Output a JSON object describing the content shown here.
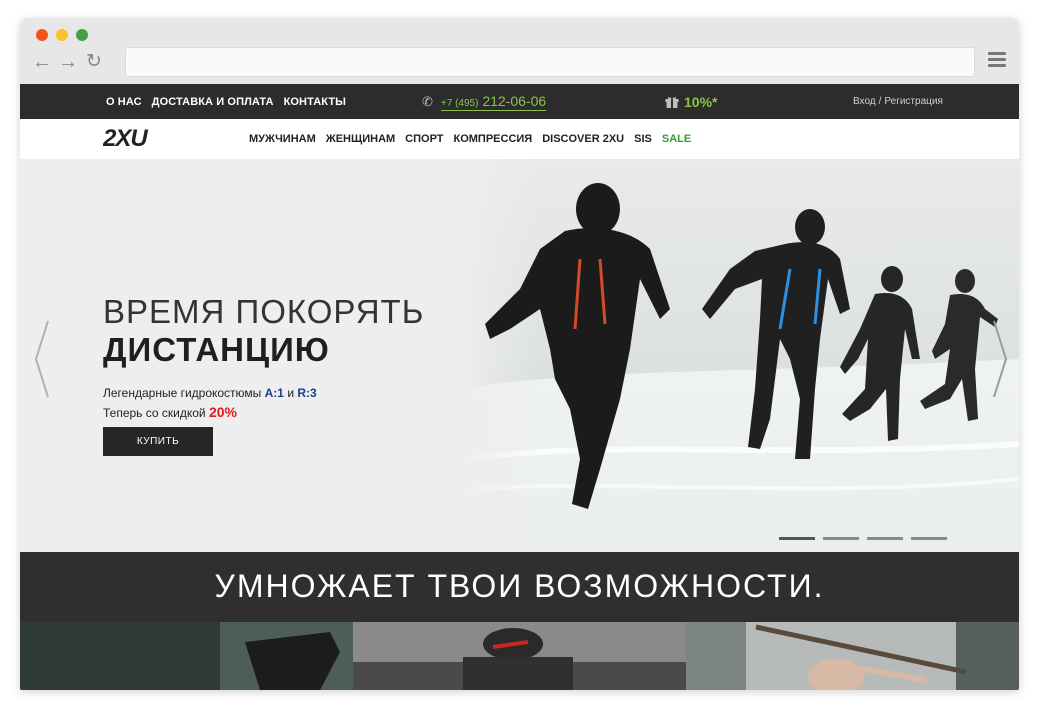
{
  "browser": {
    "url": ""
  },
  "topbar": {
    "links": [
      "О НАС",
      "ДОСТАВКА И ОПЛАТА",
      "КОНТАКТЫ"
    ],
    "phone_prefix": "+7 (495)",
    "phone_number": "212-06-06",
    "promo": "10%*",
    "login": "Вход",
    "separator": "/",
    "register": "Регистрация"
  },
  "nav": {
    "logo": "2XU",
    "items": [
      "МУЖЧИНАМ",
      "ЖЕНЩИНАМ",
      "СПОРТ",
      "КОМПРЕССИЯ",
      "DISCOVER 2XU",
      "SIS"
    ],
    "sale": "SALE"
  },
  "hero": {
    "title_line1": "ВРЕМЯ ПОКОРЯТЬ",
    "title_line2": "ДИСТАНЦИЮ",
    "sub_prefix": "Легендарные гидрокостюмы",
    "model_a": "A:1",
    "conj": "и",
    "model_b": "R:3",
    "discount_prefix": "Теперь со скидкой",
    "discount": "20%",
    "button": "КУПИТЬ",
    "slides_count": 4,
    "active_slide": 1
  },
  "slogan": "УМНОЖАЕТ ТВОИ ВОЗМОЖНОСТИ.",
  "colors": {
    "accent_green": "#8bc34a",
    "sale_green": "#2e9e2e",
    "discount_red": "#e01b1b",
    "model_blue": "#1b3f8f",
    "dark_bar": "#2c2c2c"
  }
}
